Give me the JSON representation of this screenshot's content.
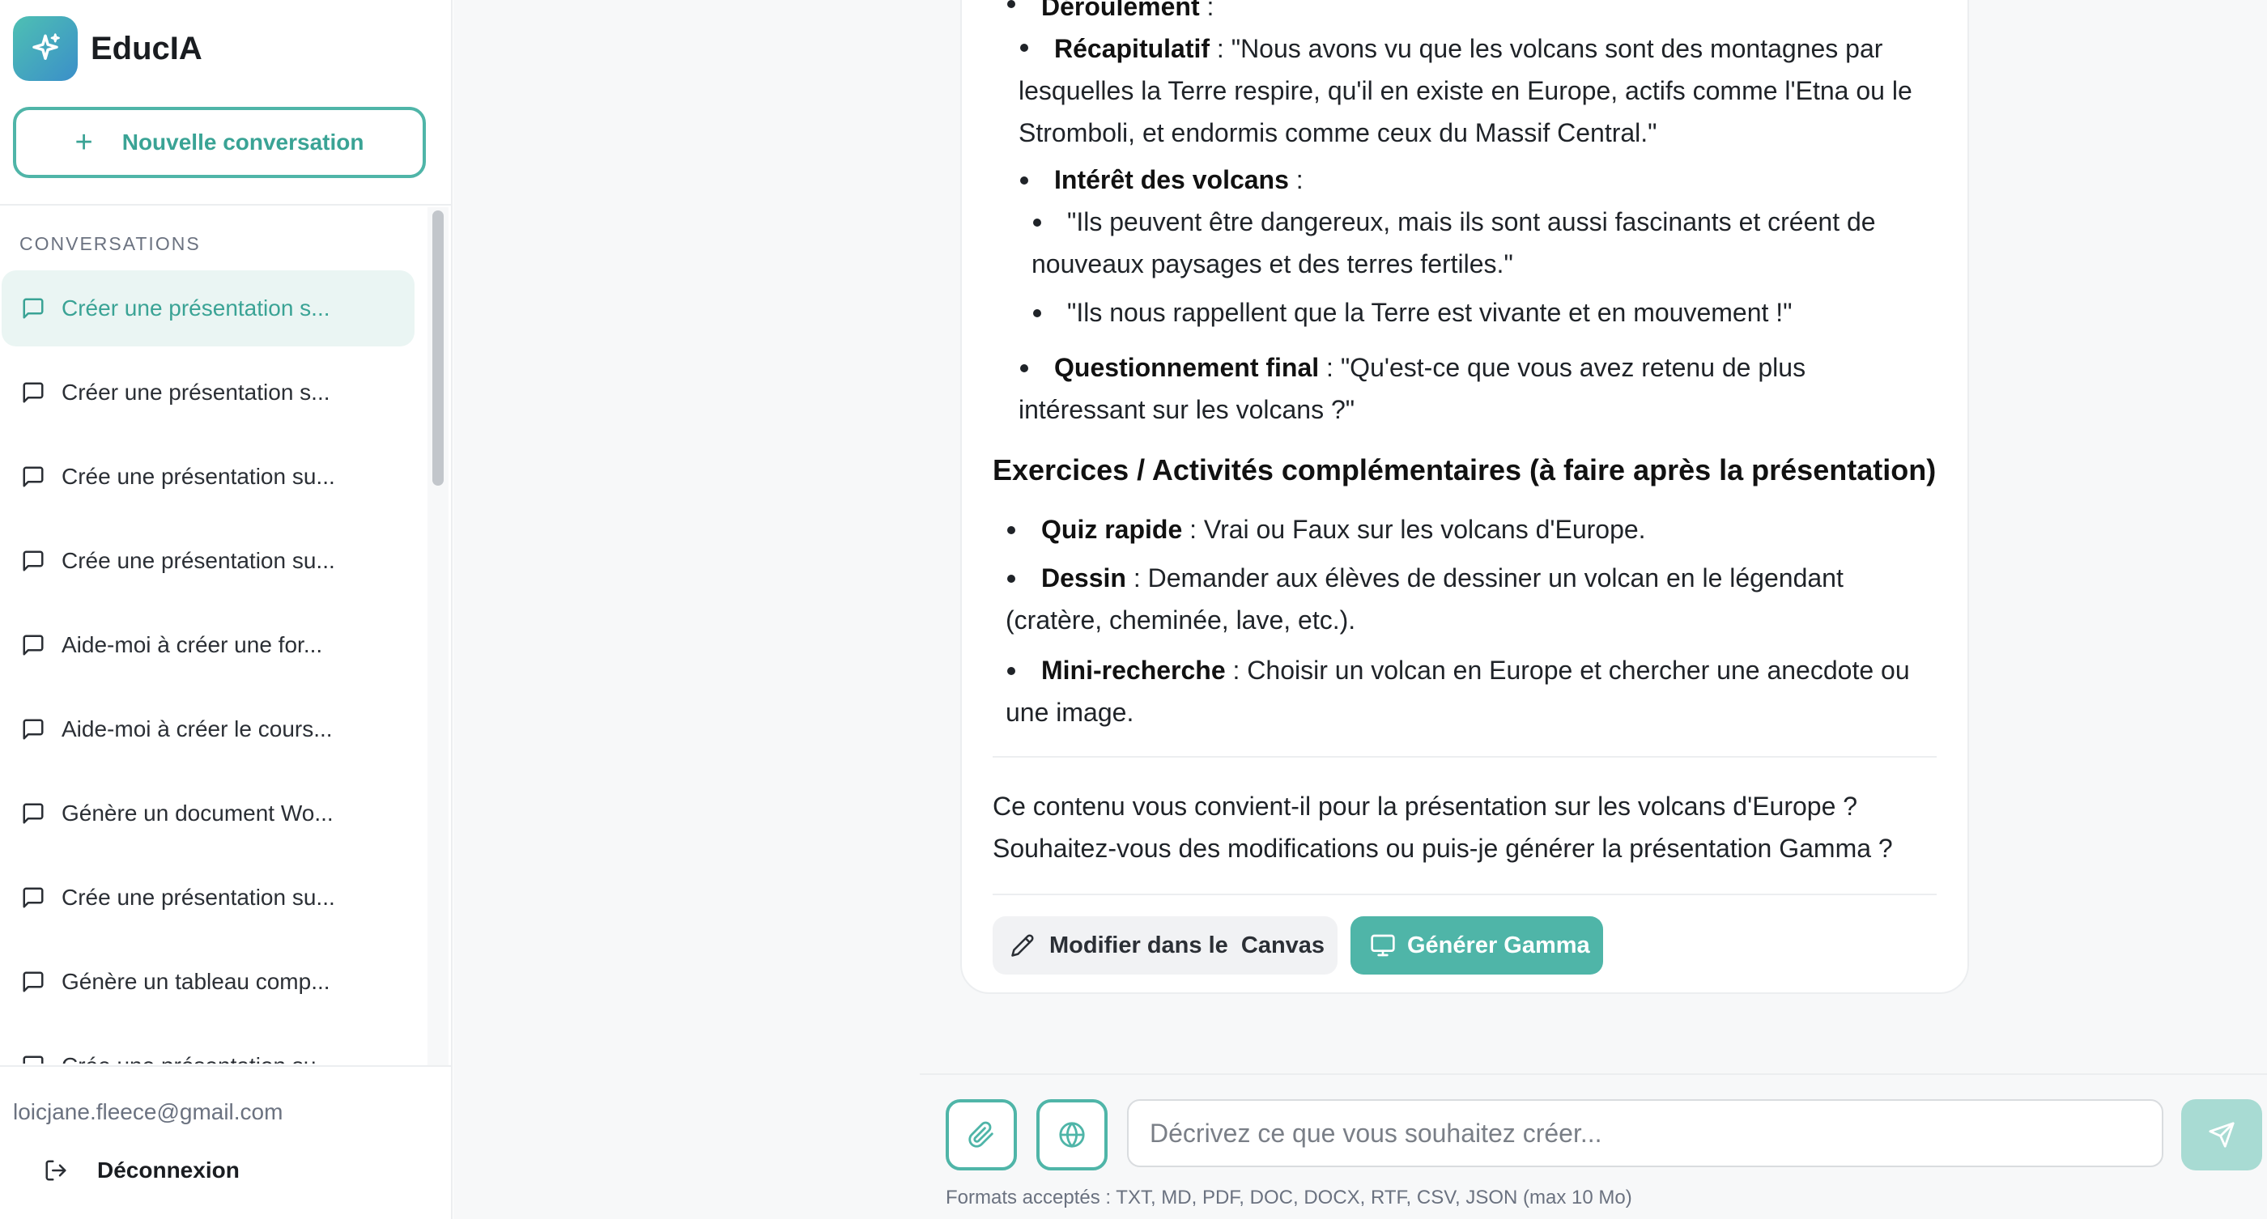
{
  "app": {
    "name": "EducIA",
    "new_conversation_label": "Nouvelle conversation",
    "conversations_title": "CONVERSATIONS",
    "user_email": "loicjane.fleece@gmail.com",
    "logout_label": "Déconnexion"
  },
  "conversations": [
    {
      "label": "Créer une présentation s...",
      "active": true
    },
    {
      "label": "Créer une présentation s...",
      "active": false
    },
    {
      "label": "Crée une présentation su...",
      "active": false
    },
    {
      "label": "Crée une présentation su...",
      "active": false
    },
    {
      "label": "Aide-moi à créer une for...",
      "active": false
    },
    {
      "label": "Aide-moi à créer le cours...",
      "active": false
    },
    {
      "label": "Génère un document Wo...",
      "active": false
    },
    {
      "label": "Crée une présentation su...",
      "active": false
    },
    {
      "label": "Génère un tableau comp...",
      "active": false
    },
    {
      "label": "Crée une présentation su...",
      "active": false
    }
  ],
  "message": {
    "deroulement_label": "Déroulement",
    "deroulement_suffix": " :",
    "recap_label": "Récapitulatif",
    "recap_line1": " : \"Nous avons vu que les volcans sont des montagnes par",
    "recap_line2": "lesquelles la Terre respire, qu'il en existe en Europe, actifs comme l'Etna ou le",
    "recap_line3": "Stromboli, et endormis comme ceux du Massif Central.\"",
    "interet_label": "Intérêt des volcans",
    "interet_suffix": " :",
    "interet_item1_line1": "\"Ils peuvent être dangereux, mais ils sont aussi fascinants et créent de",
    "interet_item1_line2": "nouveaux paysages et des terres fertiles.\"",
    "interet_item2": "\"Ils nous rappellent que la Terre est vivante et en mouvement !\"",
    "question_label": "Questionnement final",
    "question_line1": " : \"Qu'est-ce que vous avez retenu de plus",
    "question_line2": "intéressant sur les volcans ?\"",
    "exercises_heading": "Exercices / Activités complémentaires (à faire après la présentation)",
    "quiz_label": "Quiz rapide",
    "quiz_text": " : Vrai ou Faux sur les volcans d'Europe.",
    "dessin_label": "Dessin",
    "dessin_line1": " : Demander aux élèves de dessiner un volcan en le légendant",
    "dessin_line2": "(cratère, cheminée, lave, etc.).",
    "mini_label": "Mini-recherche",
    "mini_line1": " : Choisir un volcan en Europe et chercher une anecdote ou",
    "mini_line2": "une image.",
    "closing_line1": "Ce contenu vous convient-il pour la présentation sur les volcans d'Europe ?",
    "closing_line2": "Souhaitez-vous des modifications ou puis-je générer la présentation Gamma ?",
    "edit_button": "Modifier dans le  Canvas",
    "gamma_button": "Générer Gamma"
  },
  "composer": {
    "placeholder": "Décrivez ce que vous souhaitez créer...",
    "formats_note": "Formats acceptés : TXT, MD, PDF, DOC, DOCX, RTF, CSV, JSON (max 10 Mo)"
  },
  "colors": {
    "accent": "#4fb5a8",
    "accent_light": "#eaf5f3",
    "send_disabled": "#a8dbd3"
  },
  "icons": {
    "logo": "sparkles-icon",
    "new": "plus-icon",
    "conversation": "message-square-icon",
    "logout": "log-out-icon",
    "edit": "pencil-icon",
    "gamma": "presentation-icon",
    "attach": "paperclip-icon",
    "web": "globe-icon",
    "send": "send-icon"
  }
}
